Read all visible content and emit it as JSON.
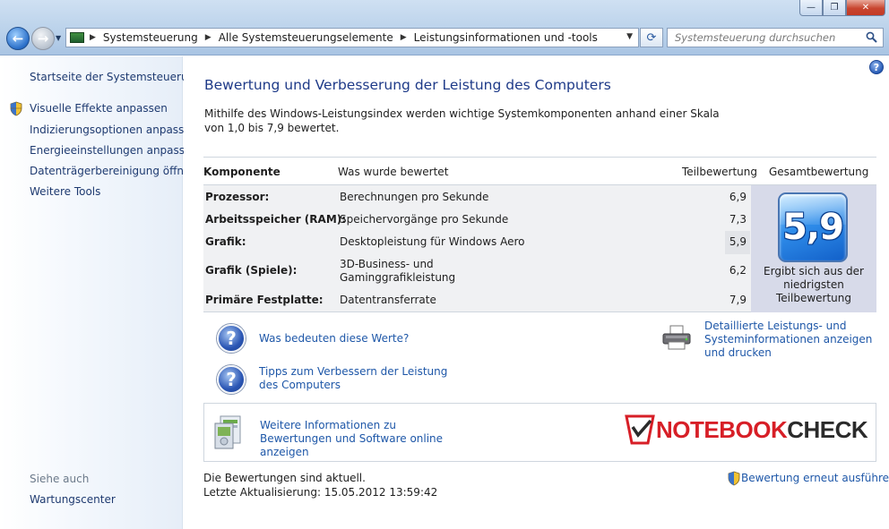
{
  "window": {
    "minimize_label": "—",
    "maximize_label": "❐",
    "close_label": "✕"
  },
  "address": {
    "breadcrumbs": [
      {
        "label": "Systemsteuerung"
      },
      {
        "label": "Alle Systemsteuerungselemente"
      },
      {
        "label": "Leistungsinformationen und -tools"
      }
    ],
    "search_placeholder": "Systemsteuerung durchsuchen"
  },
  "sidebar": {
    "items": [
      {
        "label": "Startseite der Systemsteuerung"
      },
      {
        "label": "Visuelle Effekte anpassen",
        "icon": "shield-icon"
      },
      {
        "label": "Indizierungsoptionen anpassen"
      },
      {
        "label": "Energieeinstellungen anpassen"
      },
      {
        "label": "Datenträgerbereinigung öffnen"
      },
      {
        "label": "Weitere Tools"
      }
    ],
    "see_also_heading": "Siehe auch",
    "see_also_items": [
      {
        "label": "Wartungscenter"
      }
    ]
  },
  "main": {
    "title": "Bewertung und Verbesserung der Leistung des Computers",
    "intro": "Mithilfe des Windows-Leistungsindex werden wichtige Systemkomponenten anhand einer Skala von 1,0 bis 7,9 bewertet.",
    "table": {
      "headers": {
        "component": "Komponente",
        "rated": "Was wurde bewertet",
        "subscore": "Teilbewertung",
        "basescore": "Gesamtbewertung"
      },
      "rows": [
        {
          "component": "Prozessor:",
          "rated": "Berechnungen pro Sekunde",
          "score": "6,9"
        },
        {
          "component": "Arbeitsspeicher (RAM):",
          "rated": "Speichervorgänge pro Sekunde",
          "score": "7,3"
        },
        {
          "component": "Grafik:",
          "rated": "Desktopleistung für Windows Aero",
          "score": "5,9"
        },
        {
          "component": "Grafik (Spiele):",
          "rated": "3D-Business- und Gaminggrafikleistung",
          "score": "6,2"
        },
        {
          "component": "Primäre Festplatte:",
          "rated": "Datentransferrate",
          "score": "7,9"
        }
      ],
      "base_score": "5,9",
      "base_caption": "Ergibt sich aus der niedrigsten Teilbewertung"
    },
    "links": {
      "what_mean": "Was bedeuten diese Werte?",
      "tips": "Tipps zum Verbessern der Leistung des Computers",
      "details": "Detaillierte Leistungs- und Systeminformationen anzeigen und drucken",
      "more_info": "Weitere Informationen zu Bewertungen und Software online anzeigen"
    },
    "logo": {
      "part1": "NOTEBOOK",
      "part2": "CHECK"
    },
    "status_line1": "Die Bewertungen sind aktuell.",
    "status_line2": "Letzte Aktualisierung: 15.05.2012 13:59:42",
    "rerun": "Bewertung erneut ausführen"
  },
  "colors": {
    "link": "#1e57a8",
    "title": "#1e3a88",
    "logo_red": "#d71f27"
  }
}
